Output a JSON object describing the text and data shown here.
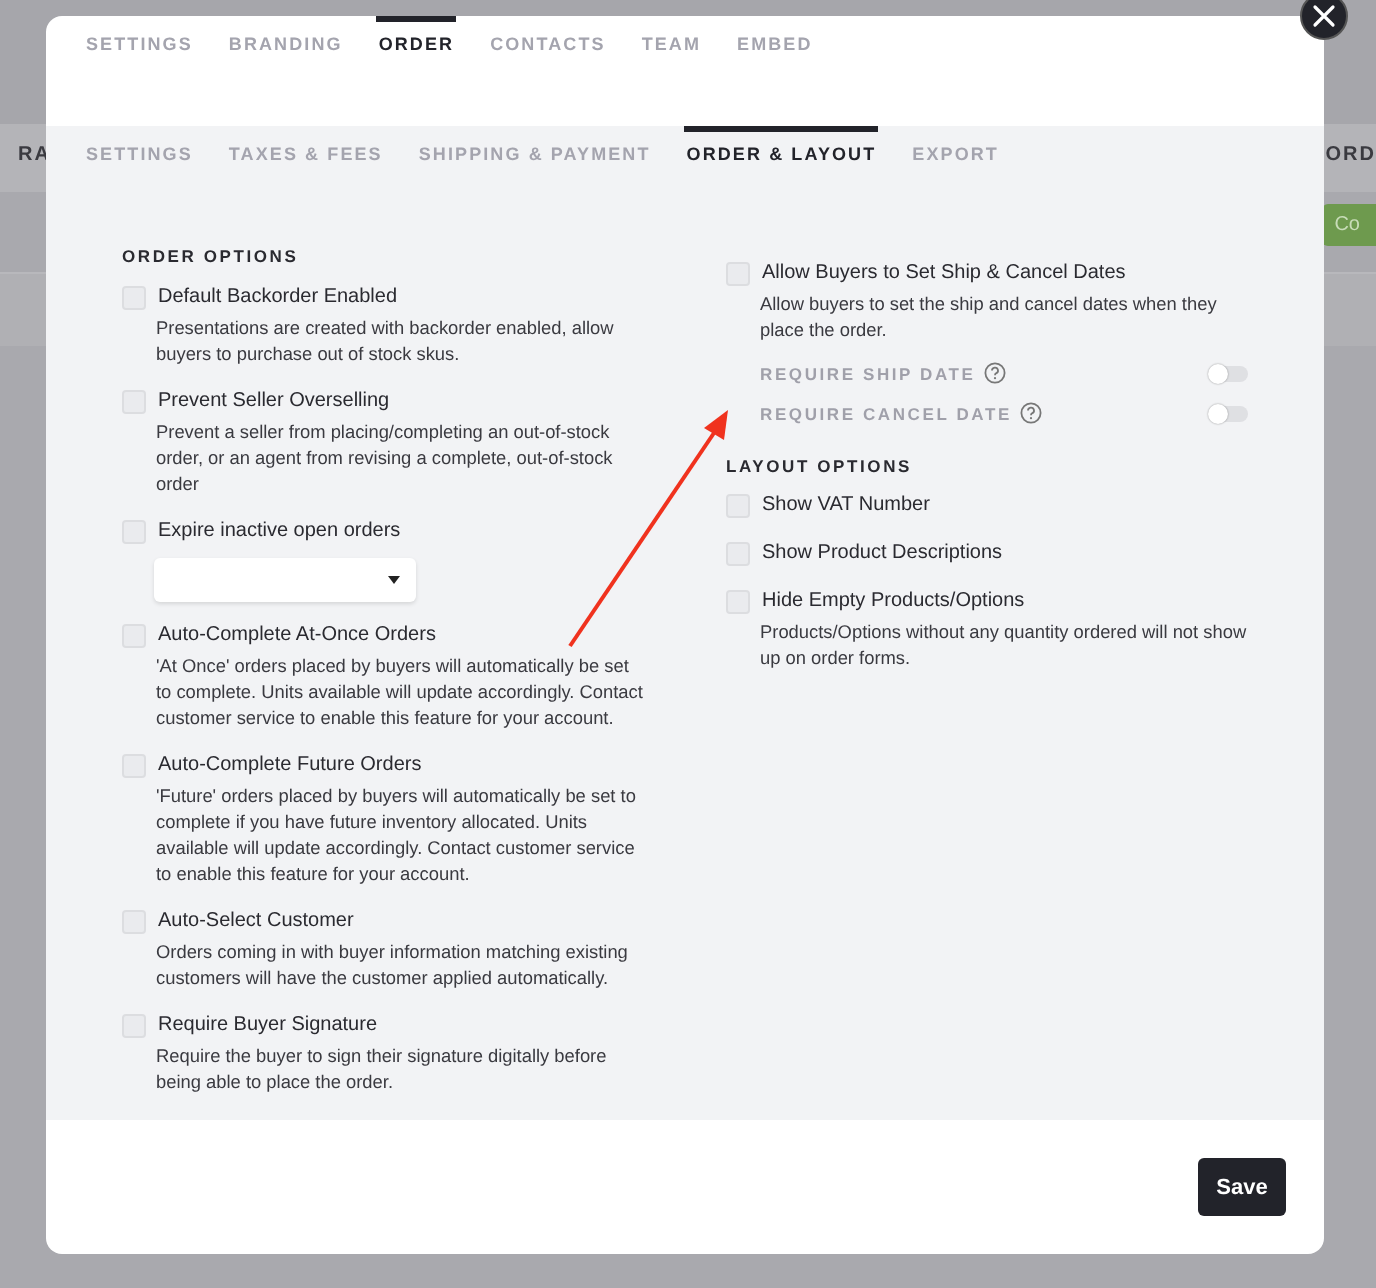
{
  "background": {
    "left_text": "RA",
    "right_text": "ORD",
    "button": "Co"
  },
  "top_tabs": [
    {
      "label": "SETTINGS",
      "selected": false
    },
    {
      "label": "BRANDING",
      "selected": false
    },
    {
      "label": "ORDER",
      "selected": true
    },
    {
      "label": "CONTACTS",
      "selected": false
    },
    {
      "label": "TEAM",
      "selected": false
    },
    {
      "label": "EMBED",
      "selected": false
    }
  ],
  "sub_tabs": [
    {
      "label": "SETTINGS",
      "selected": false
    },
    {
      "label": "TAXES & FEES",
      "selected": false
    },
    {
      "label": "SHIPPING & PAYMENT",
      "selected": false
    },
    {
      "label": "ORDER & LAYOUT",
      "selected": true
    },
    {
      "label": "EXPORT",
      "selected": false
    }
  ],
  "order_options": {
    "heading": "ORDER OPTIONS",
    "items": [
      {
        "kind": "checkbox",
        "label": "Default Backorder Enabled",
        "checked": false,
        "description": "Presentations are created with backorder enabled, allow buyers to purchase out of stock skus."
      },
      {
        "kind": "checkbox",
        "label": "Prevent Seller Overselling",
        "checked": false,
        "description": "Prevent a seller from placing/completing an out-of-stock order, or an agent from revising a complete, out-of-stock order"
      },
      {
        "kind": "select",
        "label": "Expire inactive open orders",
        "checked": false
      },
      {
        "kind": "checkbox",
        "label": "Auto-Complete At-Once Orders",
        "checked": false,
        "description": "'At Once' orders placed by buyers will automatically be set to complete. Units available will update accordingly. Contact customer service to enable this feature for your account."
      },
      {
        "kind": "checkbox",
        "label": "Auto-Complete Future Orders",
        "checked": false,
        "description": "'Future' orders placed by buyers will automatically be set to complete if you have future inventory allocated. Units available will update accordingly. Contact customer service to enable this feature for your account."
      },
      {
        "kind": "checkbox",
        "label": "Auto-Select Customer",
        "checked": false,
        "description": "Orders coming in with buyer information matching existing customers will have the customer applied automatically."
      },
      {
        "kind": "checkbox",
        "label": "Require Buyer Signature",
        "checked": false,
        "description": "Require the buyer to sign their signature digitally before being able to place the order."
      }
    ]
  },
  "date_options": {
    "label": "Allow Buyers to Set Ship & Cancel Dates",
    "checked": false,
    "description": "Allow buyers to set the ship and cancel dates when they place the order.",
    "toggles": [
      {
        "label": "REQUIRE SHIP DATE",
        "on": false
      },
      {
        "label": "REQUIRE CANCEL DATE",
        "on": false
      }
    ]
  },
  "layout_options": {
    "heading": "LAYOUT OPTIONS",
    "items": [
      {
        "kind": "checkbox",
        "label": "Show VAT Number",
        "checked": false
      },
      {
        "kind": "checkbox",
        "label": "Show Product Descriptions",
        "checked": false
      },
      {
        "kind": "checkbox",
        "label": "Hide Empty Products/Options",
        "checked": false,
        "description": "Products/Options without any quantity ordered will not show up on order forms."
      }
    ]
  },
  "save_button": "Save"
}
